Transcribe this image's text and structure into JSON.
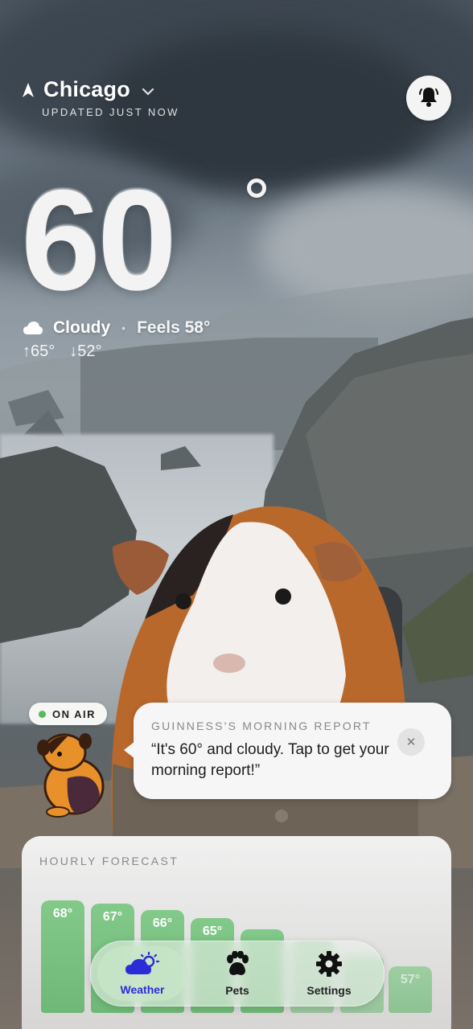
{
  "location": {
    "city": "Chicago",
    "updated": "UPDATED JUST NOW"
  },
  "current": {
    "temperature": "60",
    "condition": "Cloudy",
    "feels_like": "Feels 58°",
    "high": "65°",
    "low": "52°"
  },
  "report": {
    "on_air": "ON AIR",
    "title": "GUINNESS'S MORNING REPORT",
    "message": "“It's 60° and cloudy. Tap to get your morning report!”"
  },
  "hourly": {
    "title": "HOURLY FORECAST",
    "temps": [
      "68°",
      "67°",
      "66°",
      "65°",
      "",
      "",
      "",
      "57°"
    ]
  },
  "tabs": [
    {
      "label": "Weather",
      "icon": "weather-icon",
      "active": true
    },
    {
      "label": "Pets",
      "icon": "paw-icon",
      "active": false
    },
    {
      "label": "Settings",
      "icon": "gear-icon",
      "active": false
    }
  ],
  "colors": {
    "accent": "#2b2bd8",
    "bar_green": "#7cc384",
    "on_air_dot": "#5cb85c"
  }
}
